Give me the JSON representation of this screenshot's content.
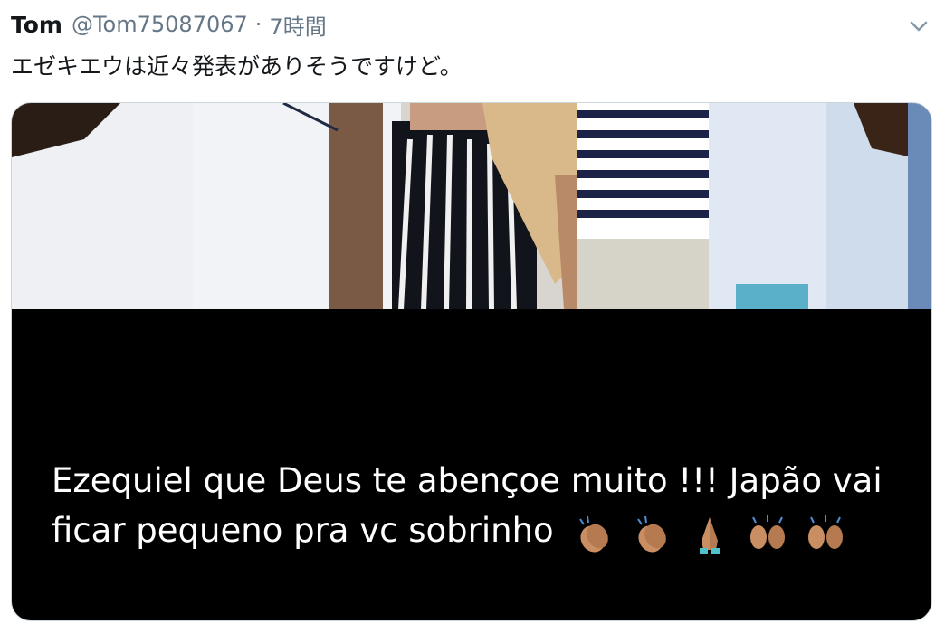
{
  "tweet": {
    "display_name": "Tom",
    "handle": "@Tom75087067",
    "separator": "·",
    "time": "7時間",
    "text": "エゼキエウは近々発表がありそうですけど。"
  },
  "media": {
    "caption": "Ezequiel que Deus te abençoe muito !!! Japão vai ficar pequeno pra vc sobrinho",
    "emojis": [
      "clapping-hands",
      "clapping-hands",
      "folded-hands",
      "raising-hands",
      "raising-hands"
    ]
  },
  "icons": {
    "menu": "chevron-down-icon"
  },
  "colors": {
    "text_primary": "#14171a",
    "text_secondary": "#657786",
    "border": "#ccd6dd",
    "media_background": "#000000"
  }
}
